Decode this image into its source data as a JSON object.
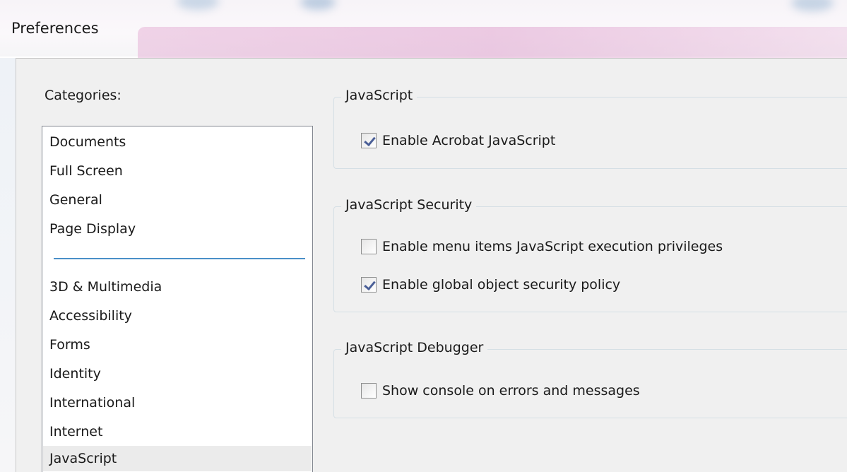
{
  "window": {
    "title": "Preferences"
  },
  "categories": {
    "label": "Categories:",
    "group_top": [
      "Documents",
      "Full Screen",
      "General",
      "Page Display"
    ],
    "group_bottom": [
      "3D & Multimedia",
      "Accessibility",
      "Forms",
      "Identity",
      "International",
      "Internet",
      "JavaScript"
    ],
    "selected": "JavaScript"
  },
  "groups": {
    "javascript": {
      "title": "JavaScript",
      "options": [
        {
          "label": "Enable Acrobat JavaScript",
          "checked": true
        }
      ]
    },
    "security": {
      "title": "JavaScript Security",
      "options": [
        {
          "label": "Enable menu items JavaScript execution privileges",
          "checked": false
        },
        {
          "label": "Enable global object security policy",
          "checked": true
        }
      ]
    },
    "debugger": {
      "title": "JavaScript Debugger",
      "options": [
        {
          "label": "Show console on errors and messages",
          "checked": false
        }
      ]
    }
  },
  "colors": {
    "selection": "#ebebeb",
    "separator": "#4a90c8",
    "checkmark": "#4a5f97"
  }
}
